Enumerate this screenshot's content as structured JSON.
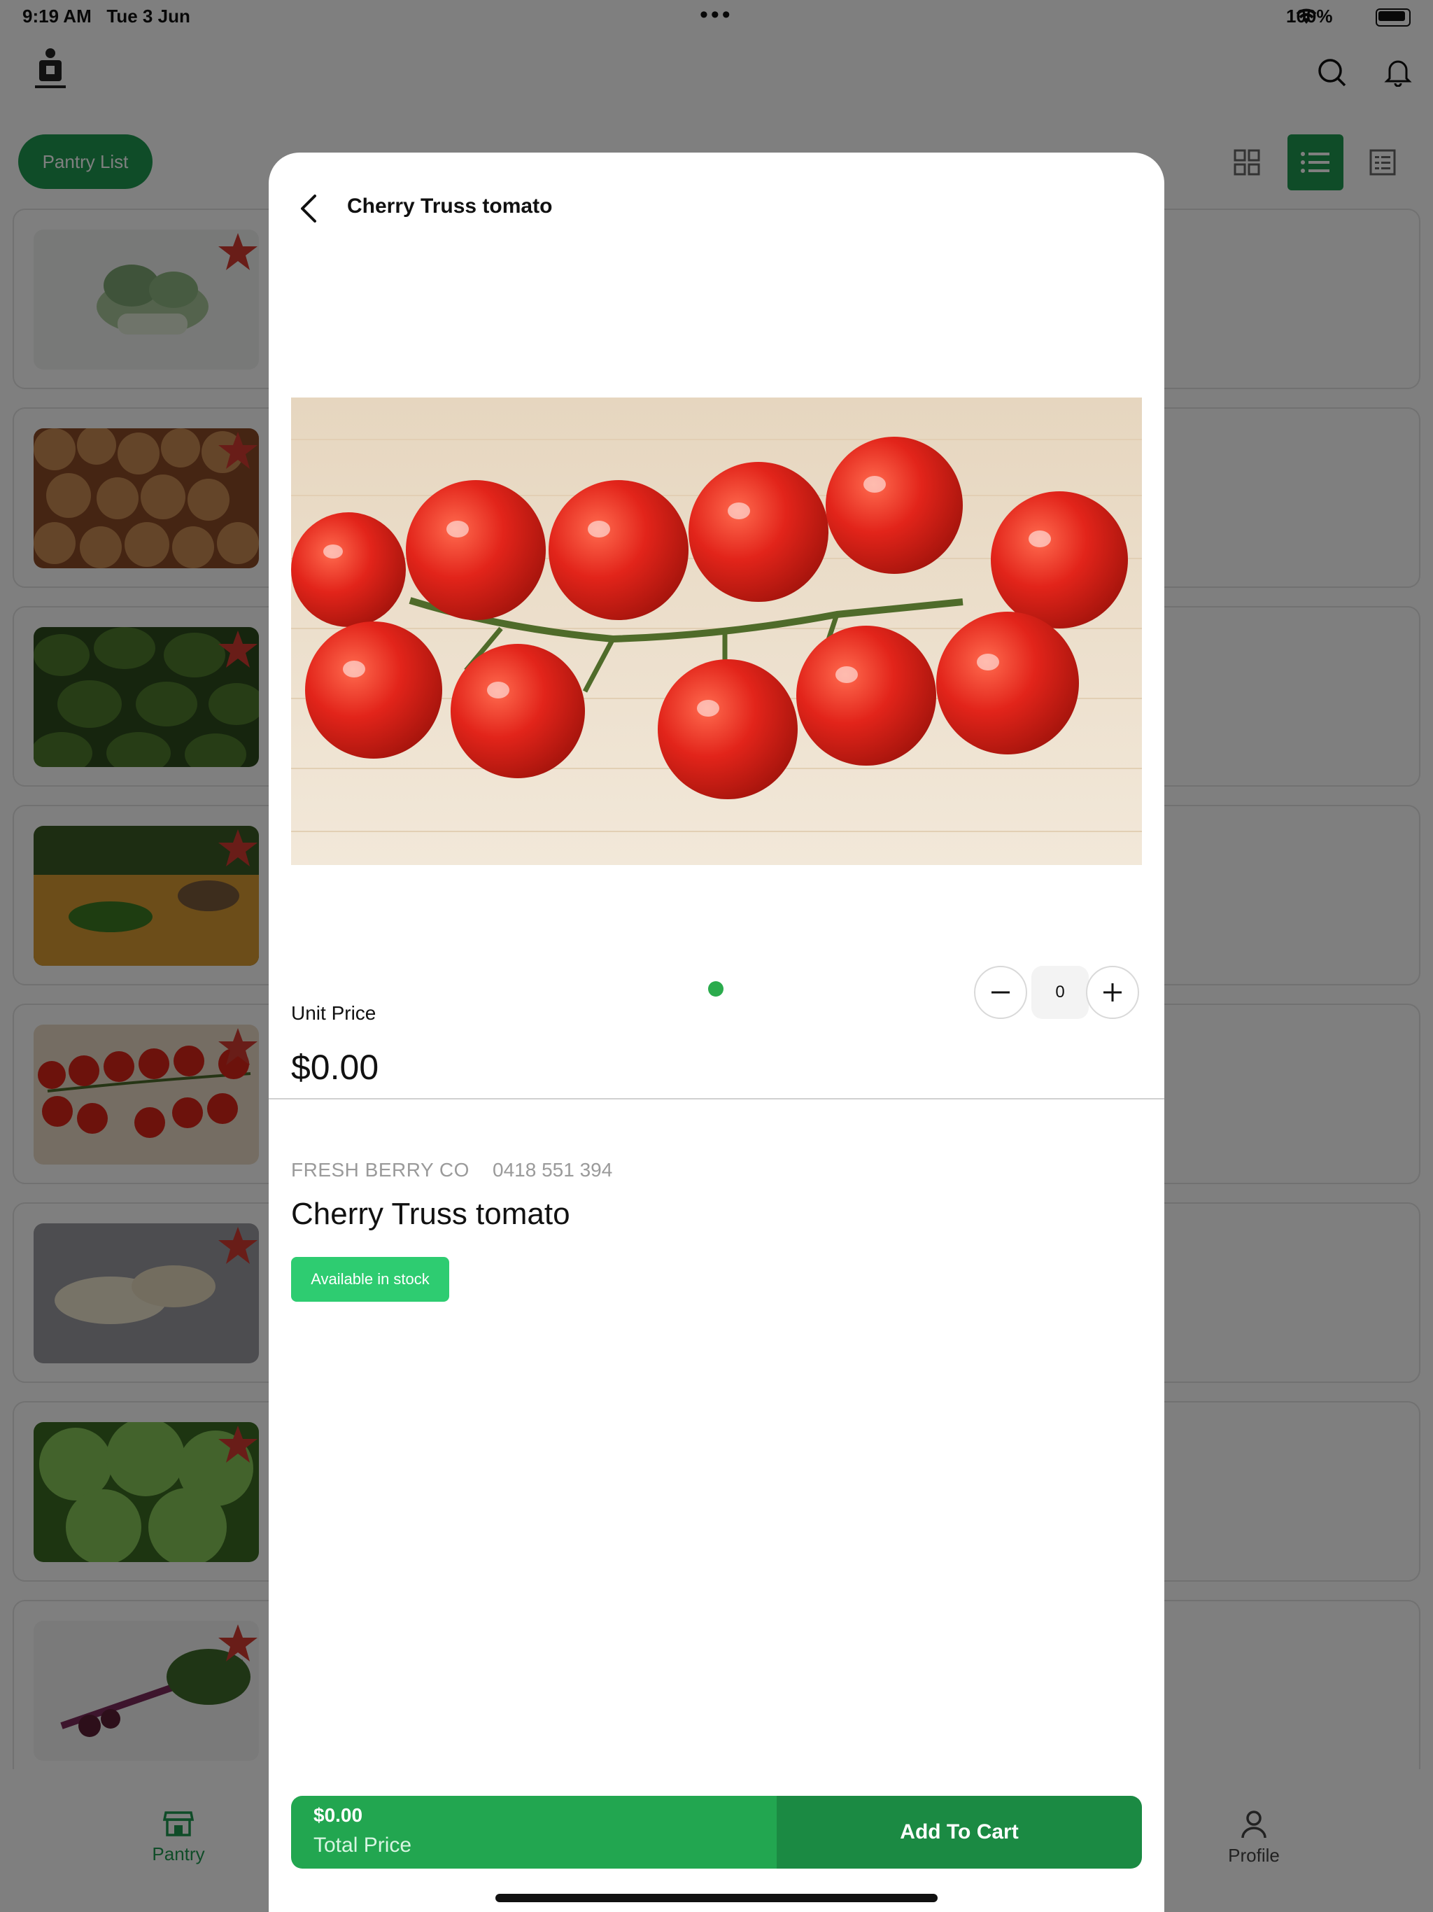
{
  "status_bar": {
    "time": "9:19 AM",
    "date": "Tue 3 Jun",
    "battery": "100%"
  },
  "header": {
    "chip_label": "Pantry List",
    "icons": [
      "search-icon",
      "bell-icon"
    ]
  },
  "view_toggle": {
    "active": "list"
  },
  "tabbar": {
    "tabs": [
      {
        "label": "Pantry",
        "icon": "store-icon"
      },
      {
        "label": "Profile",
        "icon": "person-icon"
      }
    ]
  },
  "modal": {
    "title": "Cherry Truss tomato",
    "unit_price_label": "Unit Price",
    "unit_price": "$0.00",
    "quantity": "0",
    "supplier": "FRESH BERRY CO",
    "phone": "0418 551 394",
    "product_name": "Cherry Truss tomato",
    "stock_status": "Available in stock",
    "total_value": "$0.00",
    "total_label": "Total Price",
    "add_to_cart": "Add To Cart"
  },
  "colors": {
    "brand_green": "#1e9950",
    "stock_green": "#2ecc71",
    "star_red": "#d23b30",
    "dot_green": "#2bab4d"
  }
}
